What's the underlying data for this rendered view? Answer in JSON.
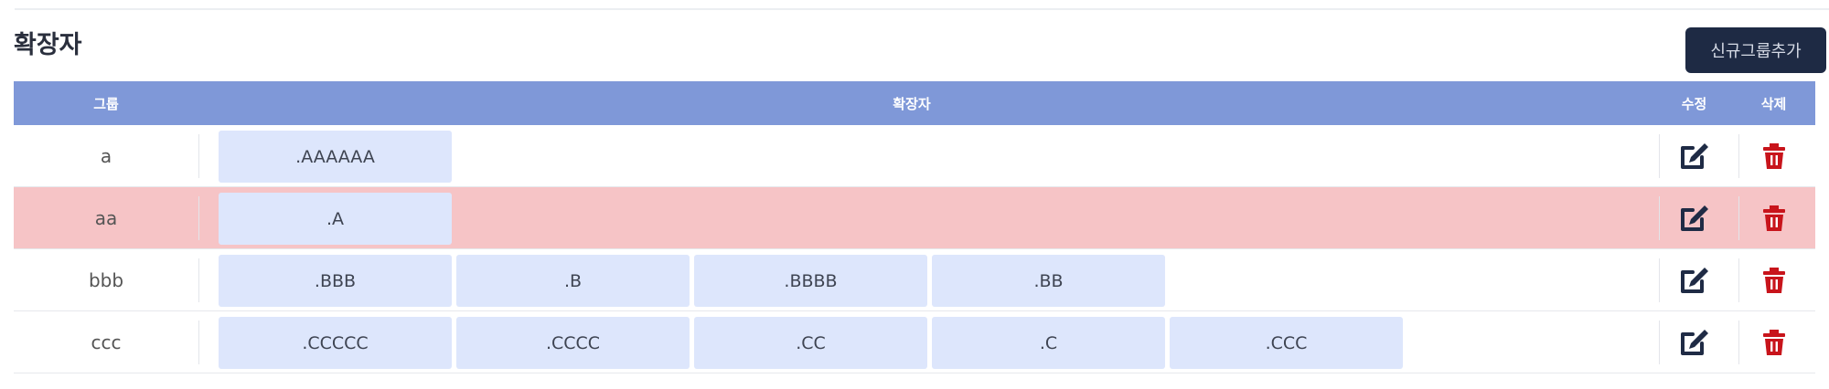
{
  "header": {
    "title": "확장자",
    "add_button_label": "신규그룹추가"
  },
  "table": {
    "columns": {
      "group": "그룹",
      "extensions": "확장자",
      "edit": "수정",
      "delete": "삭제"
    },
    "rows": [
      {
        "group": "a",
        "highlighted": false,
        "extensions": [
          ".AAAAAA"
        ]
      },
      {
        "group": "aa",
        "highlighted": true,
        "extensions": [
          ".A"
        ]
      },
      {
        "group": "bbb",
        "highlighted": false,
        "extensions": [
          ".BBB",
          ".B",
          ".BBBB",
          ".BB"
        ]
      },
      {
        "group": "ccc",
        "highlighted": false,
        "extensions": [
          ".CCCCC",
          ".CCCC",
          ".CC",
          ".C",
          ".CCC"
        ]
      }
    ]
  },
  "icons": {
    "edit": "edit-icon",
    "delete": "trash-icon"
  },
  "colors": {
    "header_bg": "#7f98d8",
    "button_bg": "#1e2a44",
    "chip_bg": "#dde6fc",
    "highlight_row": "#f6c4c6",
    "edit_icon": "#1f2b45",
    "delete_icon": "#c8141b"
  }
}
